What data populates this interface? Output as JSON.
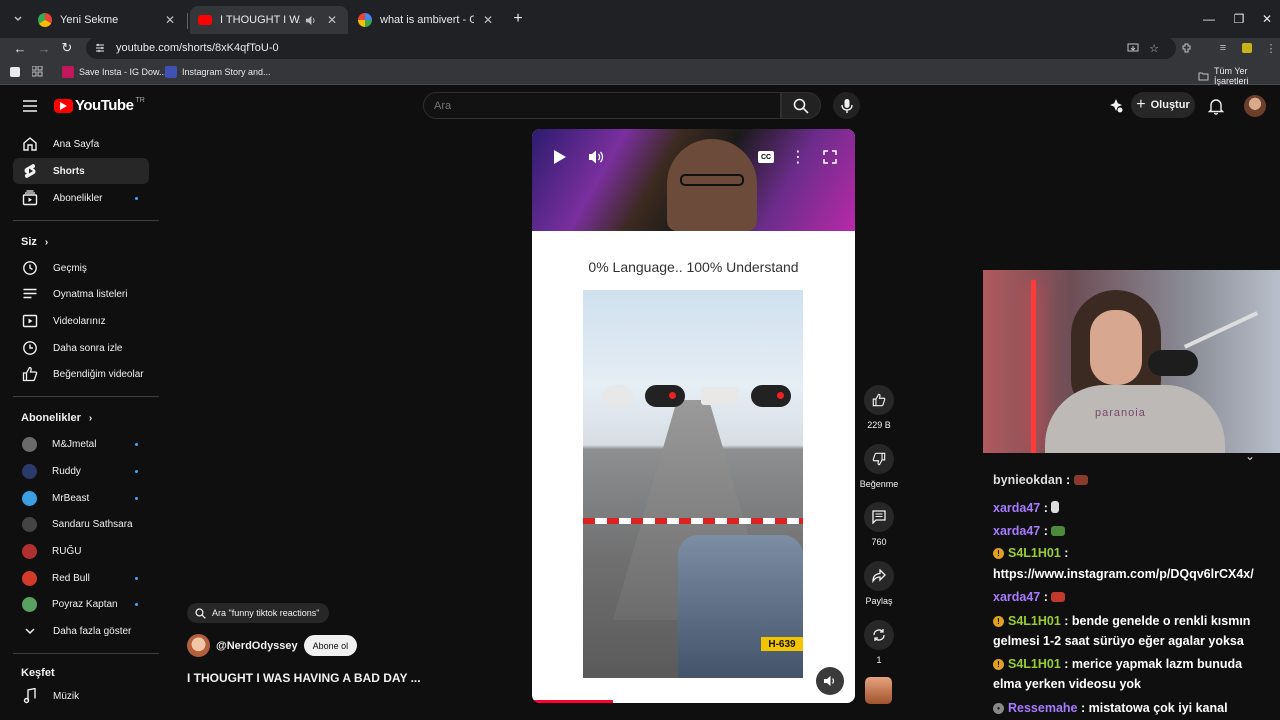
{
  "browser": {
    "tabs": [
      {
        "title": "Yeni Sekme",
        "active": false
      },
      {
        "title": "I THOUGHT I WAS HAVING",
        "active": true
      },
      {
        "title": "what is ambivert - Google'da Ar",
        "active": false
      }
    ],
    "url": "youtube.com/shorts/8xK4qfToU-0",
    "bookmarks": [
      "Save Insta - IG Dow...",
      "Instagram Story and..."
    ],
    "all_bookmarks": "Tüm Yer İşaretleri"
  },
  "youtube": {
    "logo_text": "YouTube",
    "region": "TR",
    "search_placeholder": "Ara",
    "create_label": "Oluştur"
  },
  "sidebar": {
    "main": [
      {
        "label": "Ana Sayfa",
        "icon": "home-icon"
      },
      {
        "label": "Shorts",
        "icon": "shorts-icon",
        "active": true
      },
      {
        "label": "Abonelikler",
        "icon": "subscriptions-icon",
        "dot": true
      }
    ],
    "you_heading": "Siz",
    "you": [
      {
        "label": "Geçmiş",
        "icon": "history-icon"
      },
      {
        "label": "Oynatma listeleri",
        "icon": "playlists-icon"
      },
      {
        "label": "Videolarınız",
        "icon": "your-videos-icon"
      },
      {
        "label": "Daha sonra izle",
        "icon": "watch-later-icon"
      },
      {
        "label": "Beğendiğim videolar",
        "icon": "liked-icon"
      }
    ],
    "subs_heading": "Abonelikler",
    "subs": [
      {
        "label": "M&Jmetal",
        "color": "#6a6a6a",
        "dot": true
      },
      {
        "label": "Ruddy",
        "color": "#2a3a6a",
        "dot": true
      },
      {
        "label": "MrBeast",
        "color": "#3aa0e0",
        "dot": true
      },
      {
        "label": "Sandaru Sathsara",
        "color": "#444444",
        "dot": false
      },
      {
        "label": "RUĞU",
        "color": "#b03030",
        "dot": false
      },
      {
        "label": "Red Bull",
        "color": "#d23a2a",
        "dot": true
      },
      {
        "label": "Poyraz Kaptan",
        "color": "#5aa060",
        "dot": true
      }
    ],
    "show_more": "Daha fazla göster",
    "explore_heading": "Keşfet",
    "explore": [
      {
        "label": "Müzik",
        "icon": "music-icon"
      }
    ]
  },
  "short": {
    "caption": "0% Language.. 100% Understand",
    "plate": "H-639",
    "search_chip": "Ara \"funny tiktok reactions\"",
    "channel": "@NerdOdyssey",
    "subscribe_label": "Abone ol",
    "title": "I THOUGHT I WAS HAVING A BAD DAY ...",
    "progress": 0.25,
    "actions": {
      "like_count": "229 B",
      "dislike_label": "Beğenme",
      "comments_count": "760",
      "share_label": "Paylaş",
      "remix_count": "1"
    }
  },
  "stream": {
    "shirt_text": "paranoia",
    "chat": [
      {
        "user": "bynieokdan",
        "user_color": "#ffffff",
        "sep": " : ",
        "text": "",
        "badge": false,
        "emote_color": "#8a3a2a",
        "partial": true
      },
      {
        "user": "xarda47",
        "user_color": "#a77bff",
        "sep": " : ",
        "text": "",
        "badge": false,
        "emote_color": "#dddddd"
      },
      {
        "user": "xarda47",
        "user_color": "#a77bff",
        "sep": " : ",
        "text": "",
        "badge": false,
        "emote_color": "#4a8a3a"
      },
      {
        "user": "S4L1H01",
        "user_color": "#9acd32",
        "sep": " :",
        "text": "",
        "badge": true
      },
      {
        "user": "",
        "user_color": "#ffffff",
        "sep": "",
        "text": "https://www.instagram.com/p/DQqv6lrCX4x/",
        "badge": false
      },
      {
        "user": "xarda47",
        "user_color": "#a77bff",
        "sep": " : ",
        "text": "",
        "badge": false,
        "emote_color": "#c0392b"
      },
      {
        "user": "S4L1H01",
        "user_color": "#9acd32",
        "sep": " : ",
        "text": "bende genelde o renkli kısmın",
        "badge": true
      },
      {
        "user": "",
        "user_color": "#ffffff",
        "sep": "",
        "text": "gelmesi 1-2 saat sürüyo eğer agalar yoksa",
        "badge": false
      },
      {
        "user": "S4L1H01",
        "user_color": "#9acd32",
        "sep": " : ",
        "text": "merice yapmak lazm bunuda",
        "badge": true
      },
      {
        "user": "",
        "user_color": "#ffffff",
        "sep": "",
        "text": "elma yerken videosu yok",
        "badge": false
      },
      {
        "user": "Ressemahe",
        "user_color": "#a77bff",
        "sep": " : ",
        "text": "mistatowa çok iyi kanal",
        "badge": false
      }
    ]
  },
  "colors": {
    "accent": "#ff0000",
    "progress": "#ff0033",
    "link": "#3ea6ff"
  }
}
